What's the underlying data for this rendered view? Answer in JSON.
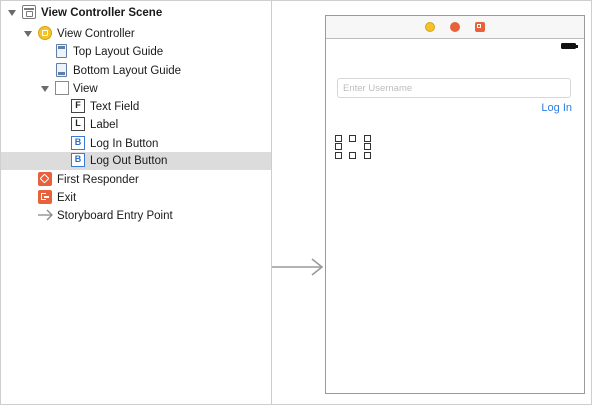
{
  "outline": {
    "scene_title": "View Controller Scene",
    "items": [
      {
        "label": "View Controller"
      },
      {
        "label": "Top Layout Guide"
      },
      {
        "label": "Bottom Layout Guide"
      },
      {
        "label": "View"
      },
      {
        "label": "Text Field",
        "badge": "F"
      },
      {
        "label": "Label",
        "badge": "L"
      },
      {
        "label": "Log In Button",
        "badge": "B"
      },
      {
        "label": "Log Out Button",
        "badge": "B",
        "selected": true
      },
      {
        "label": "First Responder"
      },
      {
        "label": "Exit"
      },
      {
        "label": "Storyboard Entry Point"
      }
    ]
  },
  "canvas": {
    "username_placeholder": "Enter Username",
    "login_label": "Log In"
  },
  "colors": {
    "accent_blue": "#2f7de1",
    "view_controller_yellow": "#f4c229",
    "responder_orange": "#e8613a",
    "selection_gray": "#dcdcdc"
  }
}
